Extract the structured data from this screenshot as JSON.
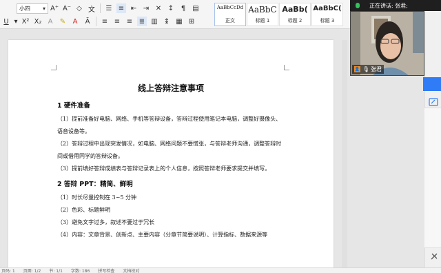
{
  "ribbon": {
    "font_size": "小四",
    "styles": [
      {
        "sample": "AaBbCcDd",
        "name": "正文"
      },
      {
        "sample": "AaBbC",
        "name": "标题 1"
      },
      {
        "sample": "AaBb(",
        "name": "标题 2"
      },
      {
        "sample": "AaBbC(",
        "name": "标题 3"
      }
    ]
  },
  "meeting": {
    "speaking_label": "正在讲话: 张君;",
    "participant_name": "张君"
  },
  "document": {
    "title": "线上答辩注意事项",
    "sections": [
      {
        "heading": "1 硬件准备",
        "paragraphs": [
          "（1）提前准备好电脑、网络、手机等答辩设备，答辩过程使用笔记本电脑，调整好摄像头、语音设备等。",
          "（2）答辩过程中出现突发情况，如电脑、网络问题不要慌张，与答辩老师沟通，调整答辩时间或借用同学的答辩设备。",
          "（3）提前填好答辩成绩表与答辩记录表上的个人信息，按照答辩老师要求提交并填写。"
        ]
      },
      {
        "heading": "2 答辩 PPT：精简、鲜明",
        "paragraphs": [
          "（1）时长尽量控制在 3~5 分钟",
          "（2）色彩、标题鲜明",
          "（3）避免文字过多，叙述不要过于冗长",
          "（4）内容：文章背景、创新点、主要内容（分章节简要说明）、计算指标、数据来源等"
        ]
      }
    ]
  },
  "statusbar": {
    "items": [
      "页码: 1",
      "页面: 1/2",
      "节: 1/1",
      "字数: 186",
      "拼写检查",
      "文档校对"
    ]
  }
}
